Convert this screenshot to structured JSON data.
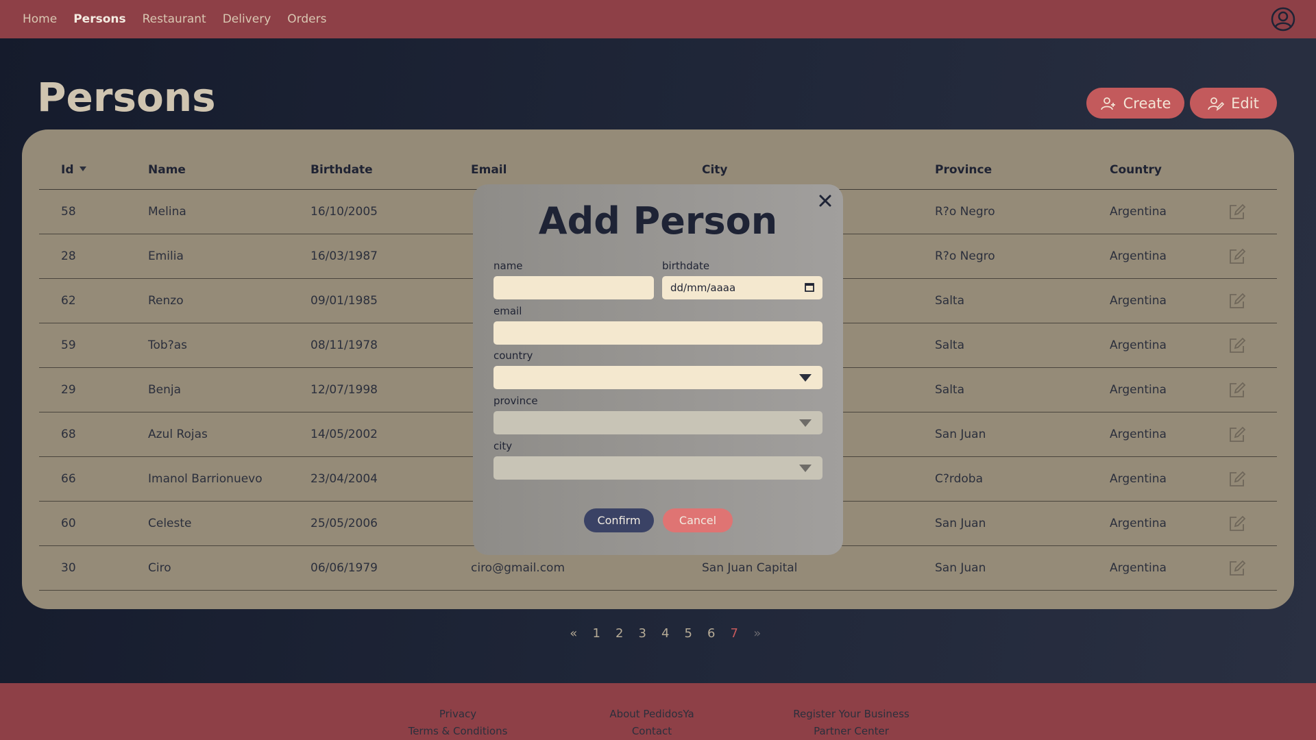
{
  "nav": {
    "items": [
      {
        "label": "Home",
        "active": false
      },
      {
        "label": "Persons",
        "active": true
      },
      {
        "label": "Restaurant",
        "active": false
      },
      {
        "label": "Delivery",
        "active": false
      },
      {
        "label": "Orders",
        "active": false
      }
    ]
  },
  "page": {
    "title": "Persons",
    "create_label": "Create",
    "edit_label": "Edit"
  },
  "table": {
    "columns": [
      "Id",
      "Name",
      "Birthdate",
      "Email",
      "City",
      "Province",
      "Country"
    ],
    "rows": [
      {
        "id": "58",
        "name": "Melina",
        "birthdate": "16/10/2005",
        "email": "",
        "city": "",
        "province": "R?o Negro",
        "country": "Argentina"
      },
      {
        "id": "28",
        "name": "Emilia",
        "birthdate": "16/03/1987",
        "email": "",
        "city": "",
        "province": "R?o Negro",
        "country": "Argentina"
      },
      {
        "id": "62",
        "name": "Renzo",
        "birthdate": "09/01/1985",
        "email": "",
        "city": "",
        "province": "Salta",
        "country": "Argentina"
      },
      {
        "id": "59",
        "name": "Tob?as",
        "birthdate": "08/11/1978",
        "email": "",
        "city": "",
        "province": "Salta",
        "country": "Argentina"
      },
      {
        "id": "29",
        "name": "Benja",
        "birthdate": "12/07/1998",
        "email": "",
        "city": "",
        "province": "Salta",
        "country": "Argentina"
      },
      {
        "id": "68",
        "name": "Azul Rojas",
        "birthdate": "14/05/2002",
        "email": "",
        "city": "",
        "province": "San Juan",
        "country": "Argentina"
      },
      {
        "id": "66",
        "name": "Imanol Barrionuevo",
        "birthdate": "23/04/2004",
        "email": "",
        "city": "",
        "province": "C?rdoba",
        "country": "Argentina"
      },
      {
        "id": "60",
        "name": "Celeste",
        "birthdate": "25/05/2006",
        "email": "",
        "city": "",
        "province": "San Juan",
        "country": "Argentina"
      },
      {
        "id": "30",
        "name": "Ciro",
        "birthdate": "06/06/1979",
        "email": "ciro@gmail.com",
        "city": "San Juan Capital",
        "province": "San Juan",
        "country": "Argentina"
      }
    ]
  },
  "pagination": {
    "prev": "«",
    "pages": [
      "1",
      "2",
      "3",
      "4",
      "5",
      "6",
      "7"
    ],
    "current": "7",
    "next": "»"
  },
  "modal": {
    "title": "Add Person",
    "fields": {
      "name": {
        "label": "name",
        "value": ""
      },
      "birthdate": {
        "label": "birthdate",
        "value": "dd/mm/aaaa"
      },
      "email": {
        "label": "email",
        "value": ""
      },
      "country": {
        "label": "country",
        "value": ""
      },
      "province": {
        "label": "province",
        "value": ""
      },
      "city": {
        "label": "city",
        "value": ""
      }
    },
    "confirm_label": "Confirm",
    "cancel_label": "Cancel"
  },
  "footer": {
    "col1": [
      "Privacy",
      "Terms & Conditions"
    ],
    "col2": [
      "About PedidosYa",
      "Contact"
    ],
    "col3": [
      "Register Your Business",
      "Partner Center"
    ]
  },
  "colors": {
    "nav_bg": "#8e4047",
    "accent": "#c35a5c",
    "card_bg": "#958b78",
    "confirm": "#3a4265",
    "cancel": "#df7473"
  }
}
